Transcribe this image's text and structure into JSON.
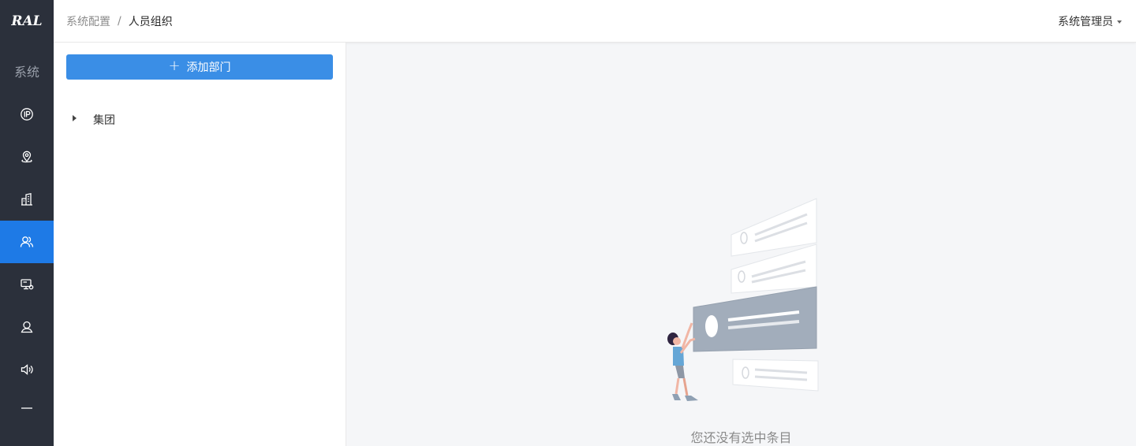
{
  "brand": {
    "logo_text": "RAL"
  },
  "sidebar": {
    "section_label": "系统",
    "items": [
      {
        "icon": "ip-icon",
        "active": false
      },
      {
        "icon": "location-pin-icon",
        "active": false
      },
      {
        "icon": "building-icon",
        "active": false
      },
      {
        "icon": "people-icon",
        "active": true
      },
      {
        "icon": "device-icon",
        "active": false
      },
      {
        "icon": "user-icon",
        "active": false
      },
      {
        "icon": "speaker-icon",
        "active": false
      },
      {
        "icon": "minus-icon",
        "active": false
      }
    ]
  },
  "header": {
    "breadcrumb": {
      "parent": "系统配置",
      "separator": "/",
      "current": "人员组织"
    },
    "user_menu": "系统管理员"
  },
  "left_panel": {
    "add_button": {
      "icon": "plus-icon",
      "label": "添加部门"
    },
    "tree": [
      {
        "label": "集团",
        "expanded": false
      }
    ]
  },
  "main": {
    "empty_message": "您还没有选中条目"
  },
  "colors": {
    "sidebar_bg": "#2b303b",
    "active_accent": "#1e7ae6",
    "button_primary": "#3a8ee6",
    "page_bg": "#f5f6f8"
  }
}
